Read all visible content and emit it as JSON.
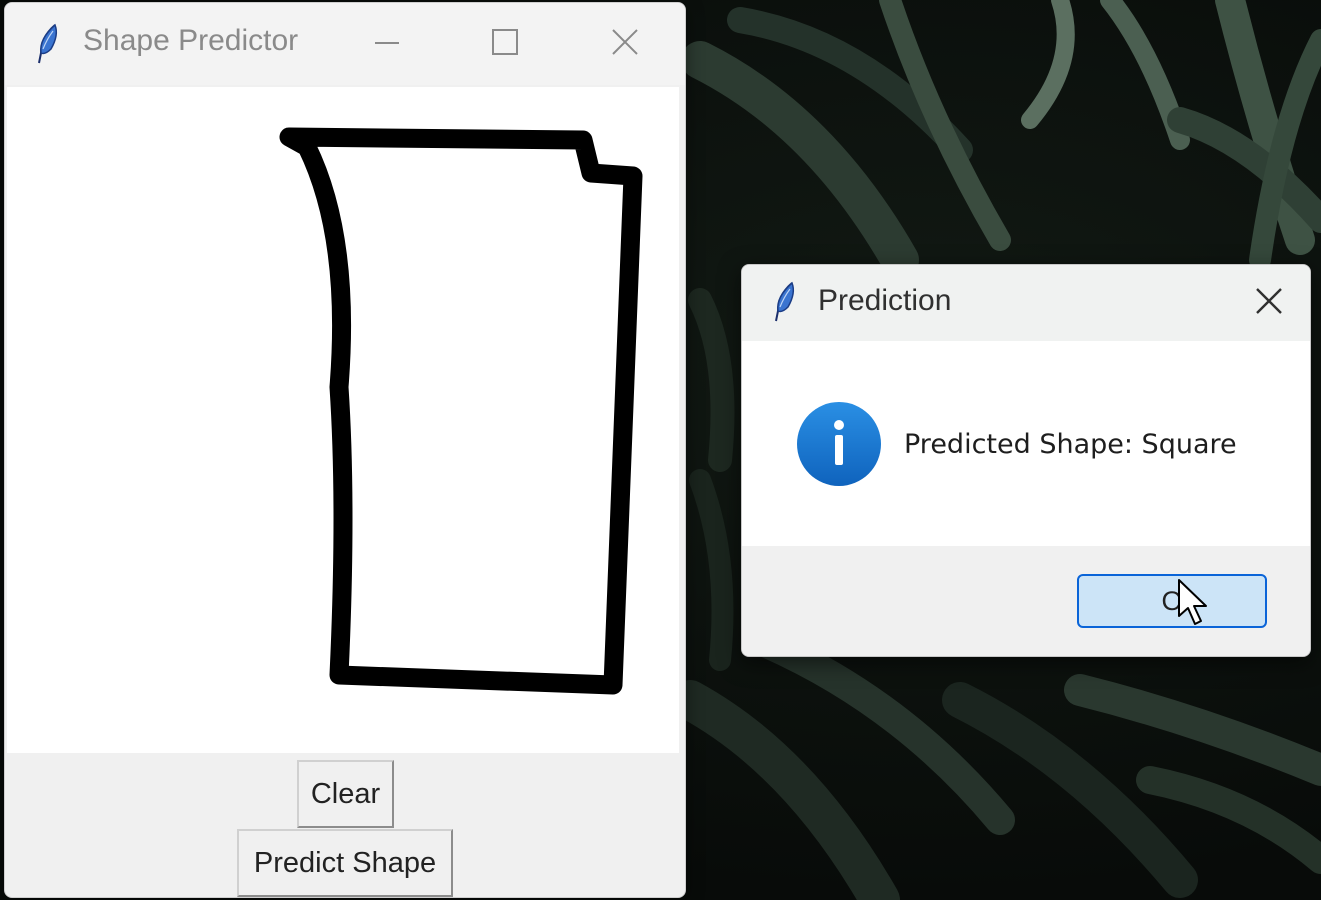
{
  "main_window": {
    "title": "Shape Predictor",
    "controls": [
      "minimize-icon",
      "maximize-icon",
      "close-icon"
    ],
    "buttons": {
      "clear": "Clear",
      "predict": "Predict Shape"
    }
  },
  "dialog": {
    "title": "Prediction",
    "message": "Predicted Shape: Square",
    "icon": "info-icon",
    "ok_label": "O"
  },
  "colors": {
    "stroke": "#000000",
    "ok_button_fill": "#cce4f7",
    "ok_button_border": "#0a64d8",
    "info_icon": "#1778d2"
  }
}
